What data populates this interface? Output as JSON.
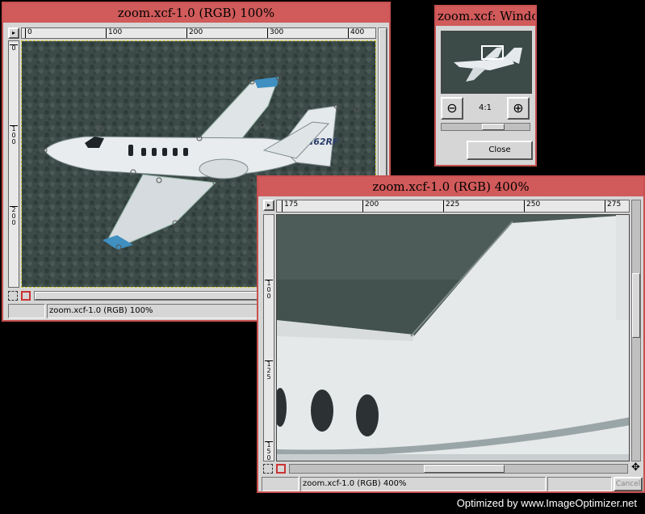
{
  "window_main": {
    "title": "zoom.xcf-1.0 (RGB) 100%",
    "status_text": "zoom.xcf-1.0 (RGB) 100%",
    "ruler_h": [
      "0",
      "100",
      "200",
      "300",
      "400"
    ],
    "ruler_v": [
      "0",
      "100",
      "200"
    ],
    "aircraft_registration": "N62RF"
  },
  "window_nav": {
    "title": "zoom.xcf: Window",
    "zoom_ratio": "4:1",
    "close_label": "Close",
    "zoom_out_icon": "magnifier-minus",
    "zoom_in_icon": "magnifier-plus"
  },
  "window_zoom": {
    "title": "zoom.xcf-1.0 (RGB) 400%",
    "status_text": "zoom.xcf-1.0 (RGB) 400%",
    "cancel_label": "Cancel",
    "ruler_h": [
      "175",
      "200",
      "225",
      "250",
      "275"
    ],
    "ruler_v": [
      "100",
      "125",
      "150"
    ]
  },
  "footer": {
    "watermark": "Optimized by www.ImageOptimizer.net"
  },
  "colors": {
    "titlebar": "#d15a5a",
    "window_bg": "#d6d6d6",
    "ground": "#3c4a48",
    "fuselage": "#e8ecee",
    "wingtip": "#3f8fc0"
  }
}
